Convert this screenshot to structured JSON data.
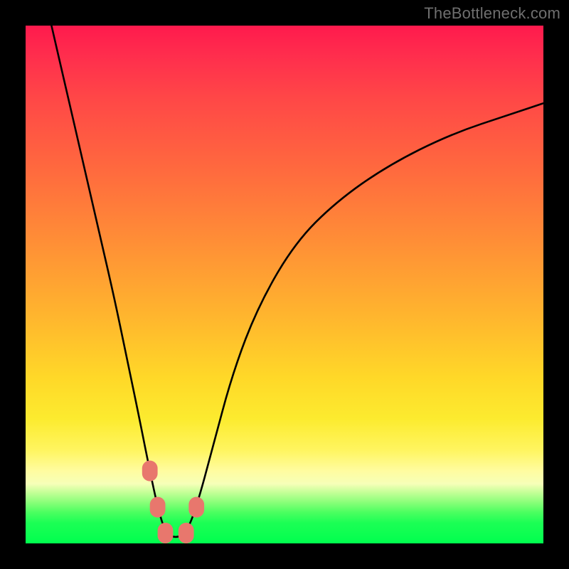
{
  "watermark": "TheBottleneck.com",
  "chart_data": {
    "type": "line",
    "title": "",
    "xlabel": "",
    "ylabel": "",
    "xlim": [
      0,
      100
    ],
    "ylim": [
      0,
      100
    ],
    "grid": false,
    "legend": false,
    "background_gradient": {
      "orientation": "vertical",
      "stops": [
        {
          "pos": 0.0,
          "color": "#ff1a4d"
        },
        {
          "pos": 0.28,
          "color": "#ff6a3e"
        },
        {
          "pos": 0.56,
          "color": "#ffb52e"
        },
        {
          "pos": 0.76,
          "color": "#fceb2f"
        },
        {
          "pos": 0.9,
          "color": "#c9ff9a"
        },
        {
          "pos": 1.0,
          "color": "#00ff4e"
        }
      ]
    },
    "series": [
      {
        "name": "bottleneck-curve",
        "color": "#000000",
        "x": [
          5.0,
          8.0,
          11.0,
          14.0,
          17.0,
          19.5,
          22.0,
          24.0,
          25.5,
          27.0,
          29.0,
          31.0,
          33.0,
          36.0,
          40.0,
          45.0,
          52.0,
          60.0,
          70.0,
          82.0,
          94.0,
          100.0
        ],
        "y": [
          100.0,
          87.0,
          74.0,
          61.0,
          48.0,
          36.0,
          24.0,
          14.0,
          7.0,
          2.0,
          1.0,
          2.0,
          7.0,
          18.0,
          33.0,
          46.0,
          58.0,
          66.0,
          73.0,
          79.0,
          83.0,
          85.0
        ]
      }
    ],
    "markers": [
      {
        "name": "marker-left-upper",
        "x": 24.0,
        "y": 14.0,
        "color": "#e8776d"
      },
      {
        "name": "marker-left-lower",
        "x": 25.5,
        "y": 7.0,
        "color": "#e8776d"
      },
      {
        "name": "marker-trough-left",
        "x": 27.0,
        "y": 2.0,
        "color": "#e8776d"
      },
      {
        "name": "marker-trough-right",
        "x": 31.0,
        "y": 2.0,
        "color": "#e8776d"
      },
      {
        "name": "marker-right-upper",
        "x": 33.0,
        "y": 7.0,
        "color": "#e8776d"
      }
    ],
    "marker_style": {
      "shape": "rounded-rect",
      "width": 3.0,
      "height": 4.0
    }
  }
}
